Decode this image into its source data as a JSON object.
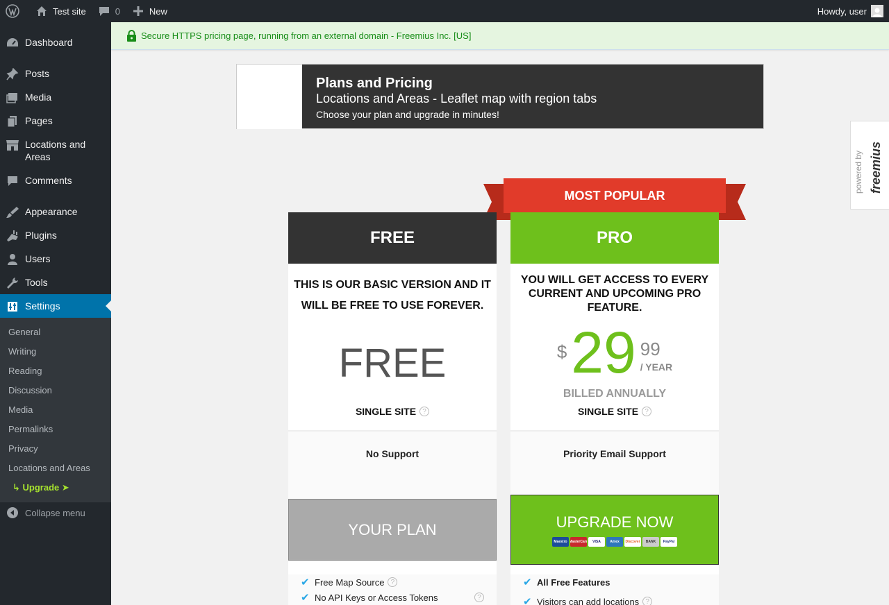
{
  "admin_bar": {
    "site_name": "Test site",
    "comments_count": "0",
    "new_label": "New",
    "greeting": "Howdy, user"
  },
  "sidebar": {
    "items": [
      {
        "label": "Dashboard",
        "icon": "dashboard-icon"
      },
      {
        "label": "Posts",
        "icon": "pin-icon"
      },
      {
        "label": "Media",
        "icon": "media-icon"
      },
      {
        "label": "Pages",
        "icon": "pages-icon"
      },
      {
        "label": "Locations and Areas",
        "icon": "store-icon"
      },
      {
        "label": "Comments",
        "icon": "comment-icon"
      },
      {
        "label": "Appearance",
        "icon": "brush-icon"
      },
      {
        "label": "Plugins",
        "icon": "plug-icon"
      },
      {
        "label": "Users",
        "icon": "user-icon"
      },
      {
        "label": "Tools",
        "icon": "wrench-icon"
      },
      {
        "label": "Settings",
        "icon": "settings-icon"
      }
    ],
    "submenu": [
      "General",
      "Writing",
      "Reading",
      "Discussion",
      "Media",
      "Permalinks",
      "Privacy",
      "Locations and Areas"
    ],
    "upgrade_label": "↳ Upgrade ➤",
    "collapse_label": "Collapse menu"
  },
  "notice": {
    "text": "Secure HTTPS pricing page, running from an external domain - Freemius Inc. [US]"
  },
  "header": {
    "title": "Plans and Pricing",
    "subtitle": "Locations and Areas - Leaflet map with region tabs",
    "tagline": "Choose your plan and upgrade in minutes!"
  },
  "powered_by": {
    "prefix": "powered by",
    "brand": "freemius"
  },
  "ribbon": {
    "label": "MOST POPULAR"
  },
  "plans": {
    "free": {
      "name": "FREE",
      "description": "THIS IS OUR BASIC VERSION AND IT WILL BE FREE TO USE FOREVER.",
      "price_text": "FREE",
      "sites": "SINGLE SITE",
      "support": "No Support",
      "cta": "YOUR PLAN",
      "features": [
        "Free Map Source",
        "No API Keys or Access Tokens"
      ]
    },
    "pro": {
      "name": "PRO",
      "description": "YOU WILL GET ACCESS TO EVERY CURRENT AND UPCOMING PRO FEATURE.",
      "currency": "$",
      "price_int": "29",
      "price_frac": "99",
      "period": "/ YEAR",
      "billing": "BILLED ANNUALLY",
      "sites": "SINGLE SITE",
      "support": "Priority Email Support",
      "cta": "UPGRADE NOW",
      "payment_methods": [
        "Maestro",
        "MasterCard",
        "VISA",
        "Amex",
        "Discover",
        "BANK",
        "PayPal"
      ],
      "features": [
        "All Free Features",
        "Visitors can add locations"
      ]
    }
  },
  "colors": {
    "accent_green": "#6ec01c",
    "ribbon_red": "#e13b2a",
    "admin_dark": "#23282d",
    "wp_blue": "#0073aa"
  }
}
